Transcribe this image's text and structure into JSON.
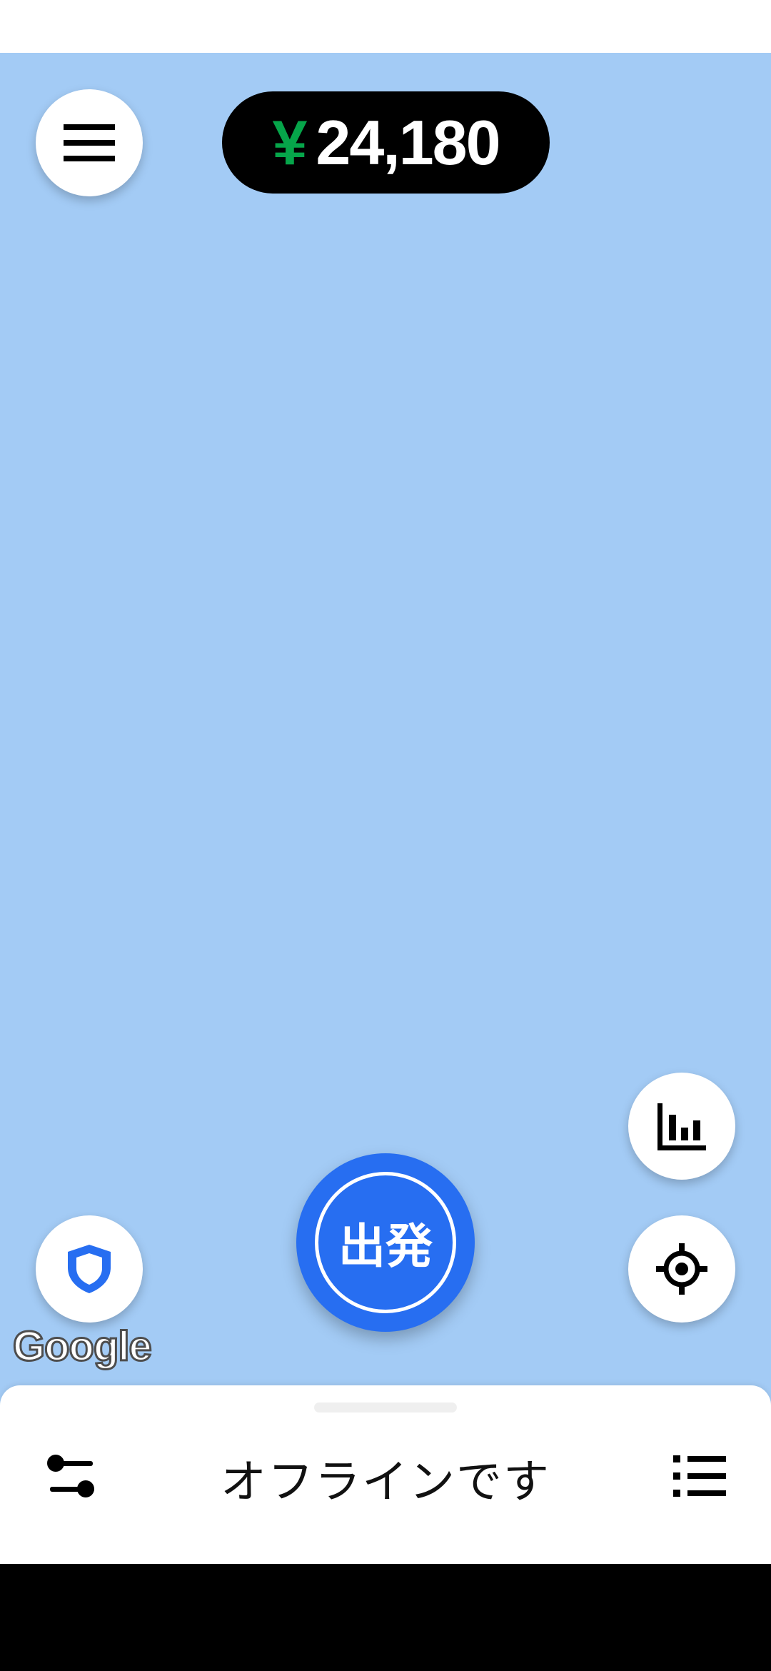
{
  "earnings": {
    "currency_symbol": "¥",
    "amount": "24,180"
  },
  "go_button": {
    "label": "出発"
  },
  "map": {
    "attribution": "Google"
  },
  "bottom_sheet": {
    "status": "オフラインです"
  },
  "icons": {
    "menu": "hamburger-menu-icon",
    "stats": "bar-chart-icon",
    "locate": "crosshair-icon",
    "safety": "shield-icon",
    "preferences": "sliders-icon",
    "list": "list-icon"
  },
  "colors": {
    "map_background": "#a3cbf5",
    "go_button": "#276ef1",
    "currency_green": "#06a54a",
    "safety_blue": "#276ef1"
  }
}
